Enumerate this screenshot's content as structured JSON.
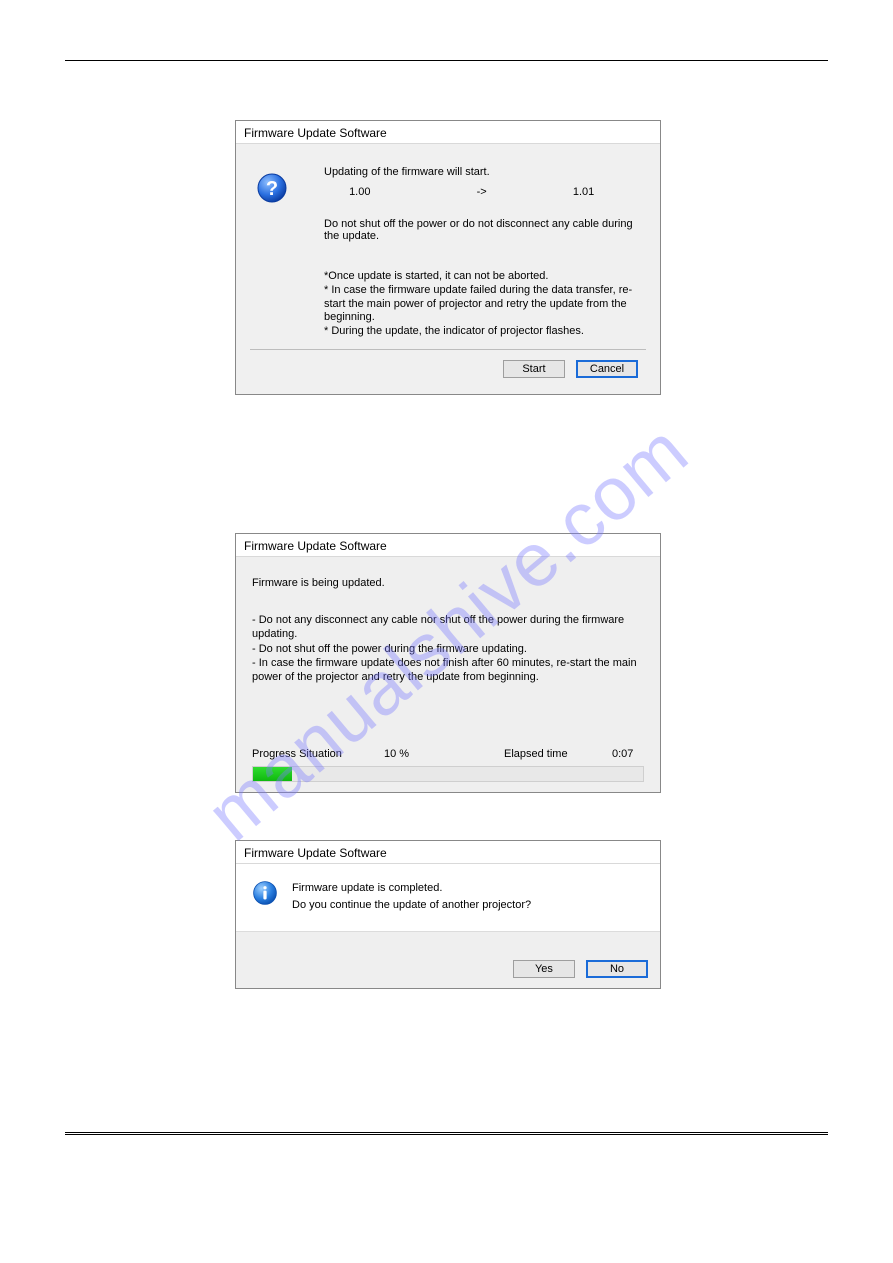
{
  "watermark": "manualshive.com",
  "dialog1": {
    "title": "Firmware Update Software",
    "line1": "Updating of the firmware will start.",
    "version_from": "1.00",
    "arrow": "->",
    "version_to": "1.01",
    "warning": "Do not shut off the power or do not disconnect any cable during the update.",
    "note1": "*Once update is started, it can not be aborted.",
    "note2": "* In case the firmware update failed during the data transfer, re-start the main power of projector and retry the update from the beginning.",
    "note3": "* During the update, the indicator of projector flashes.",
    "btn_start": "Start",
    "btn_cancel": "Cancel"
  },
  "dialog2": {
    "title": "Firmware Update Software",
    "status": "Firmware is being updated.",
    "note1": "- Do not any disconnect any cable nor shut off the power during the firmware updating.",
    "note2": "- Do not shut off the power during the firmware updating.",
    "note3": "- In case the firmware update does not finish after 60 minutes, re-start the main power of the projector and retry the update from beginning.",
    "progress_label": "Progress Situation",
    "progress_pct_text": "10 %",
    "progress_pct_num": 10,
    "elapsed_label": "Elapsed time",
    "elapsed_value": "0:07"
  },
  "dialog3": {
    "title": "Firmware Update Software",
    "msg1": "Firmware update is completed.",
    "msg2": "Do you continue the update of another projector?",
    "btn_yes": "Yes",
    "btn_no": "No"
  }
}
